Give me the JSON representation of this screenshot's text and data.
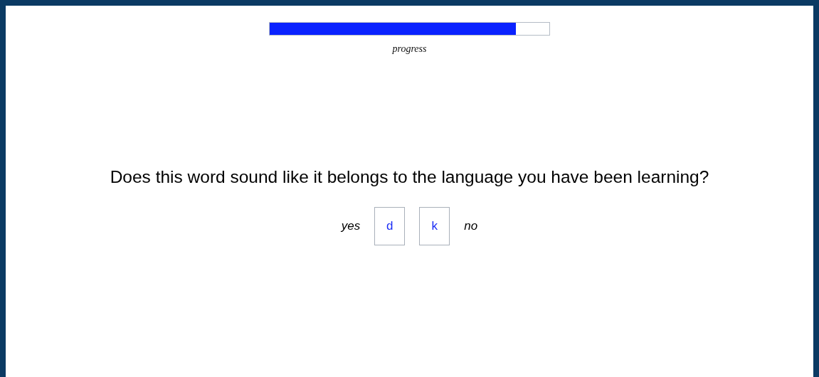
{
  "progress": {
    "level": 0.88,
    "label": "progress"
  },
  "question": "Does this word sound like it belongs to the language you have been learning?",
  "responses": {
    "left_label": "yes",
    "keys": [
      "d",
      "k"
    ],
    "right_label": "no"
  }
}
